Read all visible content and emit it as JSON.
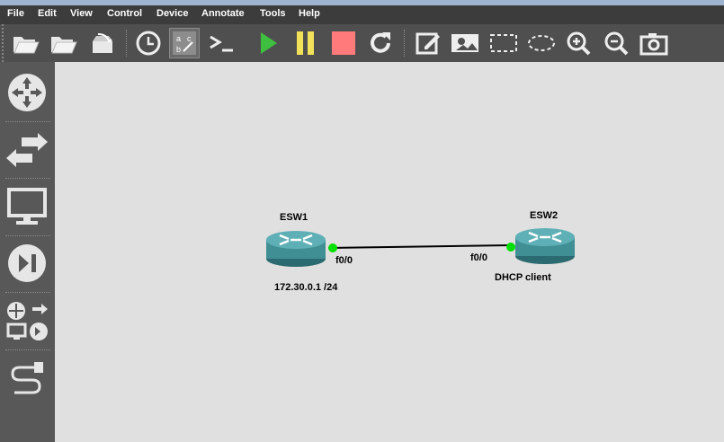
{
  "menu": [
    "File",
    "Edit",
    "View",
    "Control",
    "Device",
    "Annotate",
    "Tools",
    "Help"
  ],
  "toolbar": {
    "buttons": [
      {
        "name": "open-folder-button",
        "icon": "folder-open-icon"
      },
      {
        "name": "open-project-button",
        "icon": "folder-icon"
      },
      {
        "name": "save-snapshot-button",
        "icon": "snapshot-box-icon"
      },
      {
        "name": "history-button",
        "icon": "clock-icon"
      },
      {
        "name": "show-labels-button",
        "icon": "abc-labels-icon"
      },
      {
        "name": "console-button",
        "icon": "terminal-icon"
      },
      {
        "name": "start-button",
        "icon": "play-icon"
      },
      {
        "name": "suspend-button",
        "icon": "pause-icon"
      },
      {
        "name": "stop-button",
        "icon": "stop-icon"
      },
      {
        "name": "reload-button",
        "icon": "reload-icon"
      },
      {
        "name": "add-note-button",
        "icon": "edit-note-icon"
      },
      {
        "name": "insert-picture-button",
        "icon": "picture-icon"
      },
      {
        "name": "draw-rectangle-button",
        "icon": "rectangle-icon"
      },
      {
        "name": "draw-ellipse-button",
        "icon": "ellipse-icon"
      },
      {
        "name": "zoom-in-button",
        "icon": "zoom-in-icon"
      },
      {
        "name": "zoom-out-button",
        "icon": "zoom-out-icon"
      },
      {
        "name": "screenshot-button",
        "icon": "camera-icon"
      }
    ]
  },
  "sidebar": {
    "items": [
      {
        "name": "routers",
        "icon": "router-icon"
      },
      {
        "name": "switches",
        "icon": "switch-arrows-icon"
      },
      {
        "name": "end-devices",
        "icon": "monitor-icon"
      },
      {
        "name": "security-devices",
        "icon": "security-play-icon"
      },
      {
        "name": "all-devices",
        "icon": "all-devices-icon"
      },
      {
        "name": "add-link",
        "icon": "cable-icon"
      }
    ]
  },
  "topology": {
    "nodes": [
      {
        "id": "esw1",
        "name": "ESW1",
        "port": "f0/0",
        "note": "172.30.0.1 /24"
      },
      {
        "id": "esw2",
        "name": "ESW2",
        "port": "f0/0",
        "note": "DHCP client"
      }
    ],
    "link": {
      "from": "esw1",
      "to": "esw2",
      "status_color": "#00e000"
    }
  },
  "colors": {
    "router_body": "#3f8f95",
    "play": "#3fbf3f",
    "pause": "#f2e25a",
    "stop": "#ff7a7a"
  }
}
